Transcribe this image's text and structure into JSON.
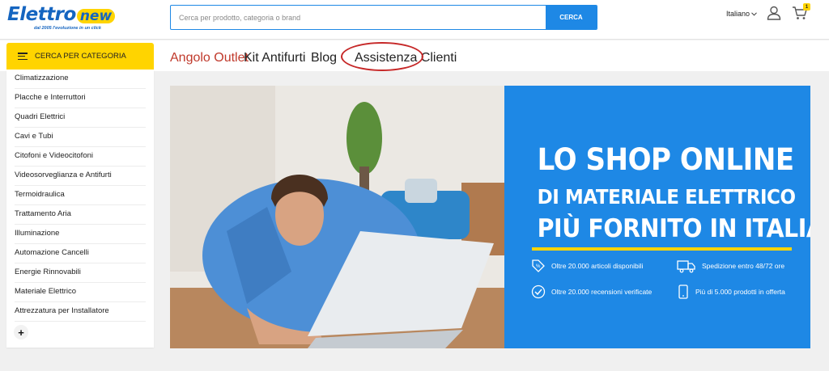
{
  "header": {
    "logo": {
      "brand_first": "Elettro",
      "brand_second": "new",
      "tagline": "dal 2005 l'evoluzione in un click"
    },
    "search": {
      "placeholder": "Cerca per prodotto, categoria o brand",
      "button_label": "CERCA"
    },
    "language": "Italiano",
    "cart_count": "1"
  },
  "nav": {
    "category_button": "CERCA PER CATEGORIA",
    "links": [
      "Angolo Outlet",
      "Kit Antifurti",
      "Blog",
      "Assistenza Clienti"
    ]
  },
  "sidebar": {
    "categories": [
      "Climatizzazione",
      "Placche e Interruttori",
      "Quadri Elettrici",
      "Cavi e Tubi",
      "Citofoni e Videocitofoni",
      "Videosorveglianza e Antifurti",
      "Termoidraulica",
      "Trattamento Aria",
      "Illuminazione",
      "Automazione Cancelli",
      "Energie Rinnovabili",
      "Materiale Elettrico",
      "Attrezzatura per Installatore"
    ]
  },
  "banner": {
    "headline_1": "LO SHOP ONLINE",
    "headline_2": "DI MATERIALE ELETTRICO",
    "headline_3": "PIÙ FORNITO IN ITALIA",
    "features": [
      "Oltre 20.000 articoli disponibili",
      "Spedizione entro 48/72 ore",
      "Oltre 20.000 recensioni verificate",
      "Più di 5.000 prodotti in offerta"
    ]
  },
  "colors": {
    "brand_blue": "#1e88e5",
    "brand_yellow": "#ffd400",
    "outlet_red": "#c0392b",
    "annotation_red": "#c62828"
  }
}
